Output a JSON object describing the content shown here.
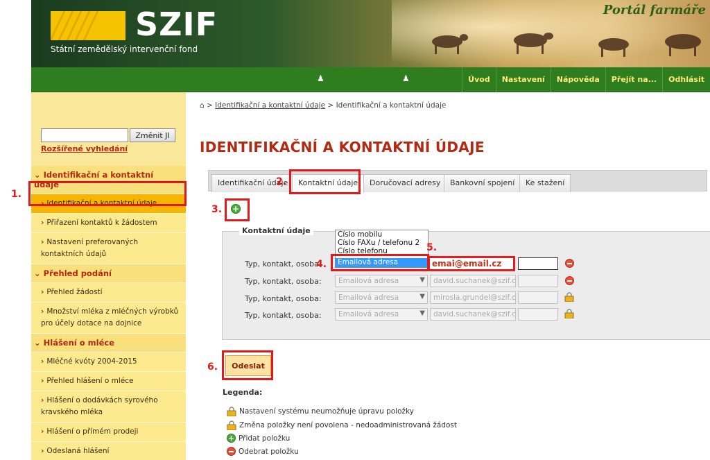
{
  "header": {
    "logo_text": "SZIF",
    "logo_subtitle": "Státní zemědělský intervenční fond",
    "portal_title": "Portál farmáře"
  },
  "nav": {
    "links": [
      "Úvod",
      "Nastavení",
      "Nápověda",
      "Přejít na...",
      "Odhlásit"
    ]
  },
  "sidebar": {
    "search_placeholder": "",
    "search_button": "Změnit JI",
    "advanced_search": "Rozšířené vyhledání",
    "sections": [
      {
        "title": "Identifikační a kontaktní údaje",
        "items": [
          "Identifikační a kontaktní údaje",
          "Přiřazení kontaktů k žádostem",
          "Nastavení preferovaných kontaktních údajů"
        ]
      },
      {
        "title": "Přehled podání",
        "items": [
          "Přehled žádostí",
          "Množství mléka z mléčných výrobků pro účely dotace na dojnice"
        ]
      },
      {
        "title": "Hlášení o mléce",
        "items": [
          "Mléčné kvóty 2004-2015",
          "Přehled hlášení o mléce",
          "Hlášení o dodávkách syrového kravského mléka",
          "Hlášení o přímém prodeji",
          "Odeslaná hlášení"
        ]
      }
    ]
  },
  "breadcrumb": {
    "link": "Identifikační a kontaktní údaje",
    "current": "Identifikační a kontaktní údaje",
    "separator": ">"
  },
  "page_title": "IDENTIFIKAČNÍ A KONTAKTNÍ ÚDAJE",
  "tabs": [
    "Identifikační údaje",
    "Kontaktní údaje",
    "Doručovací adresy",
    "Bankovní spojení",
    "Ke stažení"
  ],
  "contact_form": {
    "legend": "Kontaktní údaje",
    "row_label": "Typ, kontakt, osoba:",
    "rows": [
      {
        "type": "Emailová adresa",
        "value": "emai@email.cz"
      },
      {
        "type": "Emailová adresa",
        "value": "david.suchanek@szif.cz"
      },
      {
        "type": "Emailová adresa",
        "value": "mirosla.grundel@szif.cz"
      },
      {
        "type": "Emailová adresa",
        "value": "david.suchanek@szif.cz"
      }
    ],
    "dropdown_options": [
      "Číslo mobilu",
      "Číslo FAXu / telefonu 2",
      "Číslo telefonu",
      "Emailová adresa"
    ]
  },
  "submit_label": "Odeslat",
  "legend": {
    "title": "Legenda:",
    "items": [
      "Nastavení systému neumožňuje úpravu položky",
      "Změna položky není povolena - nedoadministrovaná žádost",
      "Přidat položku",
      "Odebrat položku"
    ]
  },
  "annotations": [
    "1.",
    "2.",
    "3.",
    "4.",
    "5.",
    "6."
  ],
  "colors": {
    "accent_red": "#b22a12",
    "nav_green": "#2e7d1e",
    "sidebar_yellow": "#fbe79a",
    "active_item": "#f7b500",
    "annotation_red": "#e01a1a"
  }
}
